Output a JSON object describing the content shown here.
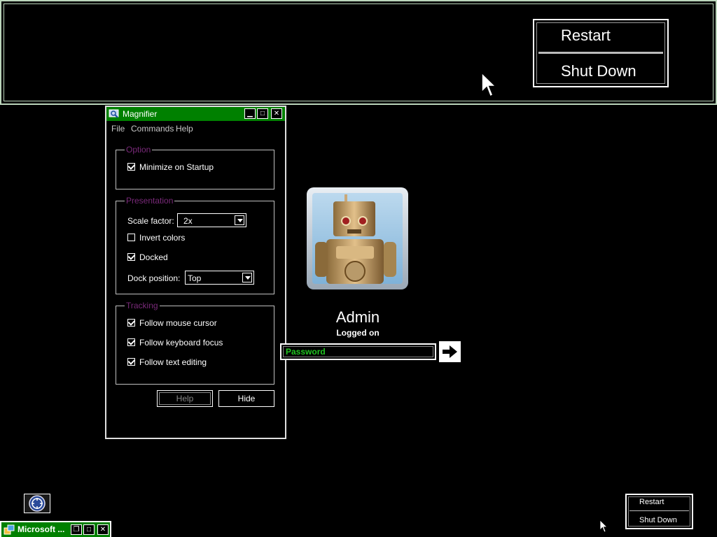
{
  "zoomed_menu": {
    "restart": "Restart",
    "shutdown": "Shut Down"
  },
  "magnifier": {
    "title": "Magnifier",
    "menu": [
      "File",
      "Commands",
      "Help"
    ],
    "option": {
      "legend": "Option",
      "minimize_on_startup": {
        "label": "Minimize on Startup",
        "checked": true
      }
    },
    "presentation": {
      "legend": "Presentation",
      "scale_label": "Scale factor:",
      "scale_value": "2x",
      "invert": {
        "label": "Invert colors",
        "checked": false
      },
      "docked": {
        "label": "Docked",
        "checked": true
      },
      "dock_label": "Dock position:",
      "dock_value": "Top"
    },
    "tracking": {
      "legend": "Tracking",
      "follow_mouse": {
        "label": "Follow mouse cursor",
        "checked": true
      },
      "follow_keyboard": {
        "label": "Follow keyboard focus",
        "checked": true
      },
      "follow_text": {
        "label": "Follow text editing",
        "checked": true
      }
    },
    "buttons": {
      "help": "Help",
      "hide": "Hide"
    }
  },
  "logon": {
    "username": "Admin",
    "status": "Logged on",
    "password_placeholder": "Password"
  },
  "taskbar": {
    "label": "Microsoft ..."
  },
  "power_menu": {
    "restart": "Restart",
    "shutdown": "Shut Down"
  },
  "colors": {
    "title_green": "#008000",
    "legend_purple": "#7a2a7a",
    "placeholder_green": "#21c521"
  }
}
